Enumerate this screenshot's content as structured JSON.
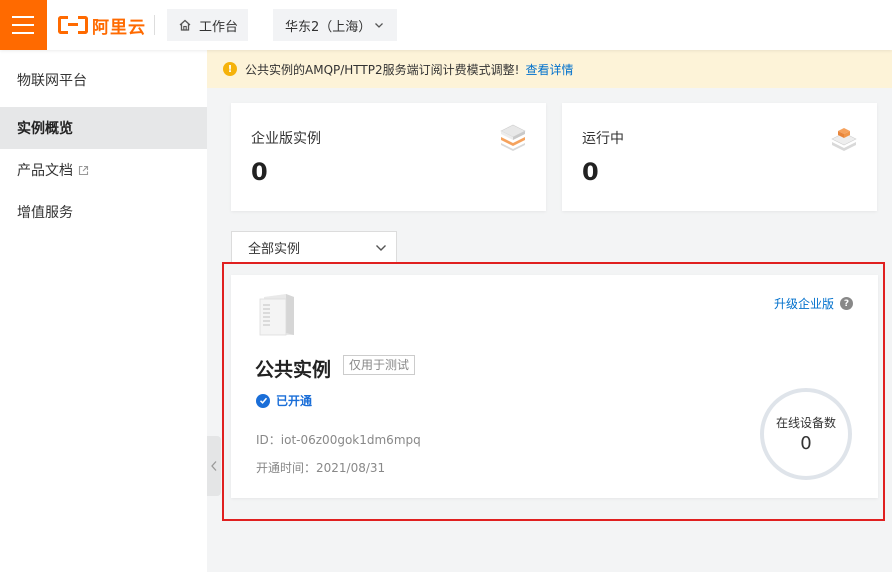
{
  "header": {
    "brand": "阿里云",
    "workbench_label": "工作台",
    "region_label": "华东2（上海）"
  },
  "sidebar": {
    "title": "物联网平台",
    "items": [
      {
        "label": "实例概览",
        "active": true
      },
      {
        "label": "产品文档",
        "external": true
      },
      {
        "label": "增值服务"
      }
    ]
  },
  "notice": {
    "text": "公共实例的AMQP/HTTP2服务端订阅计费模式调整!",
    "link": "查看详情"
  },
  "stats": [
    {
      "label": "企业版实例",
      "value": "0"
    },
    {
      "label": "运行中",
      "value": "0"
    }
  ],
  "filter": {
    "selected": "全部实例"
  },
  "instance": {
    "name": "公共实例",
    "tag": "仅用于测试",
    "status": "已开通",
    "id_line": "ID：iot-06z00gok1dm6mpq",
    "open_time_line": "开通时间：2021/08/31",
    "upgrade_link": "升级企业版",
    "online_label": "在线设备数",
    "online_value": "0"
  },
  "colors": {
    "brand": "#ff6a00",
    "link": "#0070cc",
    "status": "#1a6ed8",
    "highlight": "#e02020",
    "notice_bg": "#fdf3d8"
  }
}
